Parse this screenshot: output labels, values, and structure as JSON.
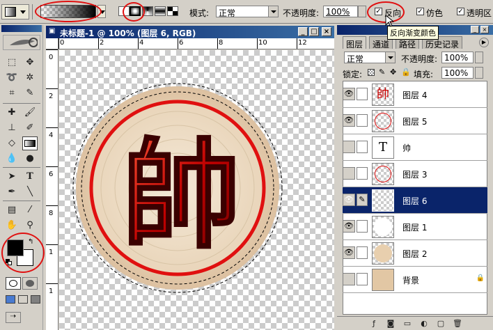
{
  "options_bar": {
    "mode_label": "模式:",
    "mode_value": "正常",
    "opacity_label": "不透明度:",
    "opacity_value": "100%",
    "reverse_label": "反向",
    "dither_label": "仿色",
    "transparency_label": "透明区",
    "tooltip": "反向渐变颜色"
  },
  "document": {
    "title": "未标题-1 @ 100% (图层 6, RGB)",
    "ruler_h": [
      "0",
      "2",
      "4",
      "6",
      "8",
      "10",
      "12"
    ],
    "ruler_v": [
      "0",
      "2",
      "4",
      "6",
      "8",
      "1",
      "1"
    ],
    "character": "帥"
  },
  "layers_panel": {
    "tabs": [
      "图层",
      "通道",
      "路径",
      "历史记录"
    ],
    "blend_mode": "正常",
    "opacity_label": "不透明度:",
    "opacity_value": "100%",
    "lock_label": "锁定:",
    "fill_label": "填充:",
    "fill_value": "100%",
    "layers": [
      {
        "name": "图层 4",
        "visible": true,
        "thumb": "帥"
      },
      {
        "name": "图层 5",
        "visible": true,
        "thumb": ""
      },
      {
        "name": "帅",
        "visible": false,
        "thumb": "T"
      },
      {
        "name": "图层 3",
        "visible": false,
        "thumb": ""
      },
      {
        "name": "图层 6",
        "visible": true,
        "thumb": "",
        "selected": true
      },
      {
        "name": "图层 1",
        "visible": true,
        "thumb": ""
      },
      {
        "name": "图层 2",
        "visible": true,
        "thumb": ""
      },
      {
        "name": "背景",
        "visible": false,
        "thumb": ""
      }
    ]
  },
  "colors": {
    "accent_red": "#e01010",
    "selection_blue": "#0a246a",
    "foreground": "#000000",
    "background": "#ffffff"
  }
}
